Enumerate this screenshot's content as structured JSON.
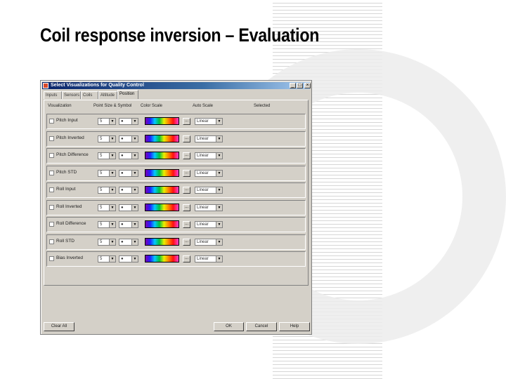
{
  "slide": {
    "title": "Coil response inversion – Evaluation"
  },
  "dialog": {
    "title": "Select Visualizations for Quality Control",
    "controls": {
      "minimize": "_",
      "maximize": "□",
      "close": "×"
    },
    "tabs": [
      "Inputs",
      "Sensors",
      "Coils",
      "Altitude",
      "Position"
    ],
    "active_tab": "Position",
    "columns": [
      "Visualization",
      "Point Size & Symbol",
      "Color Scale",
      "Auto Scale",
      "Selected"
    ],
    "rows": [
      {
        "label": "Pitch Input",
        "size": "5",
        "symbol": "●",
        "scale_button": "...",
        "auto_scale": "Linear"
      },
      {
        "label": "Pitch Inverted",
        "size": "5",
        "symbol": "●",
        "scale_button": "...",
        "auto_scale": "Linear"
      },
      {
        "label": "Pitch Difference",
        "size": "5",
        "symbol": "●",
        "scale_button": "...",
        "auto_scale": "Linear"
      },
      {
        "label": "Pitch STD",
        "size": "5",
        "symbol": "●",
        "scale_button": "...",
        "auto_scale": "Linear"
      },
      {
        "label": "Roll Input",
        "size": "5",
        "symbol": "●",
        "scale_button": "...",
        "auto_scale": "Linear"
      },
      {
        "label": "Roll Inverted",
        "size": "5",
        "symbol": "●",
        "scale_button": "...",
        "auto_scale": "Linear"
      },
      {
        "label": "Roll Difference",
        "size": "5",
        "symbol": "●",
        "scale_button": "...",
        "auto_scale": "Linear"
      },
      {
        "label": "Roll STD",
        "size": "5",
        "symbol": "●",
        "scale_button": "...",
        "auto_scale": "Linear"
      },
      {
        "label": "Bias Inverted",
        "size": "5",
        "symbol": "●",
        "scale_button": "...",
        "auto_scale": "Linear"
      }
    ],
    "dropdown_arrow": "▼",
    "buttons": {
      "clear_all": "Clear All",
      "ok": "OK",
      "cancel": "Cancel",
      "help": "Help"
    }
  }
}
